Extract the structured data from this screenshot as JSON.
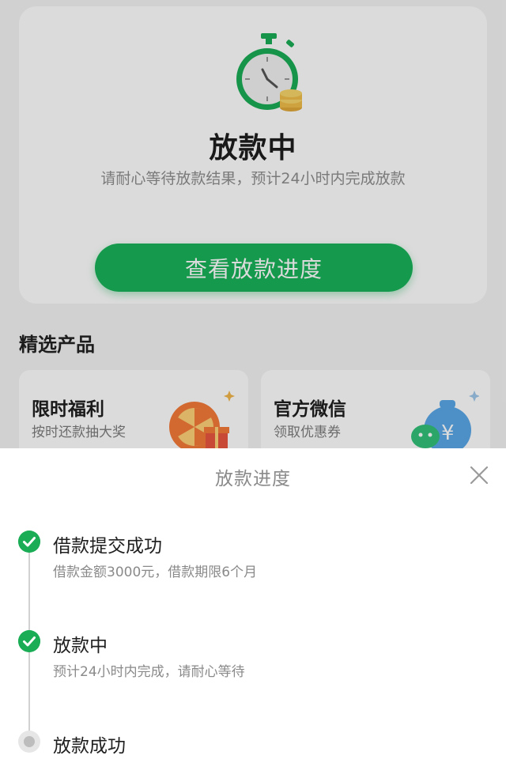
{
  "status_card": {
    "title": "放款中",
    "subtitle": "请耐心等待放款结果，预计24小时内完成放款",
    "button_label": "查看放款进度"
  },
  "products": {
    "section_title": "精选产品",
    "items": [
      {
        "title": "限时福利",
        "subtitle": "按时还款抽大奖",
        "icon": "prize-wheel-icon"
      },
      {
        "title": "官方微信",
        "subtitle": "领取优惠券",
        "icon": "wechat-money-bag-icon"
      }
    ]
  },
  "sheet": {
    "title": "放款进度",
    "close_icon": "close-icon",
    "steps": [
      {
        "title": "借款提交成功",
        "desc": "借款金额3000元，借款期限6个月",
        "status": "done"
      },
      {
        "title": "放款中",
        "desc": "预计24小时内完成，请耐心等待",
        "status": "done"
      },
      {
        "title": "放款成功",
        "desc": "",
        "status": "pending"
      }
    ]
  },
  "colors": {
    "accent_green": "#19b45a",
    "done_green": "#1aad55",
    "pending_gray": "#bdbdbd"
  }
}
